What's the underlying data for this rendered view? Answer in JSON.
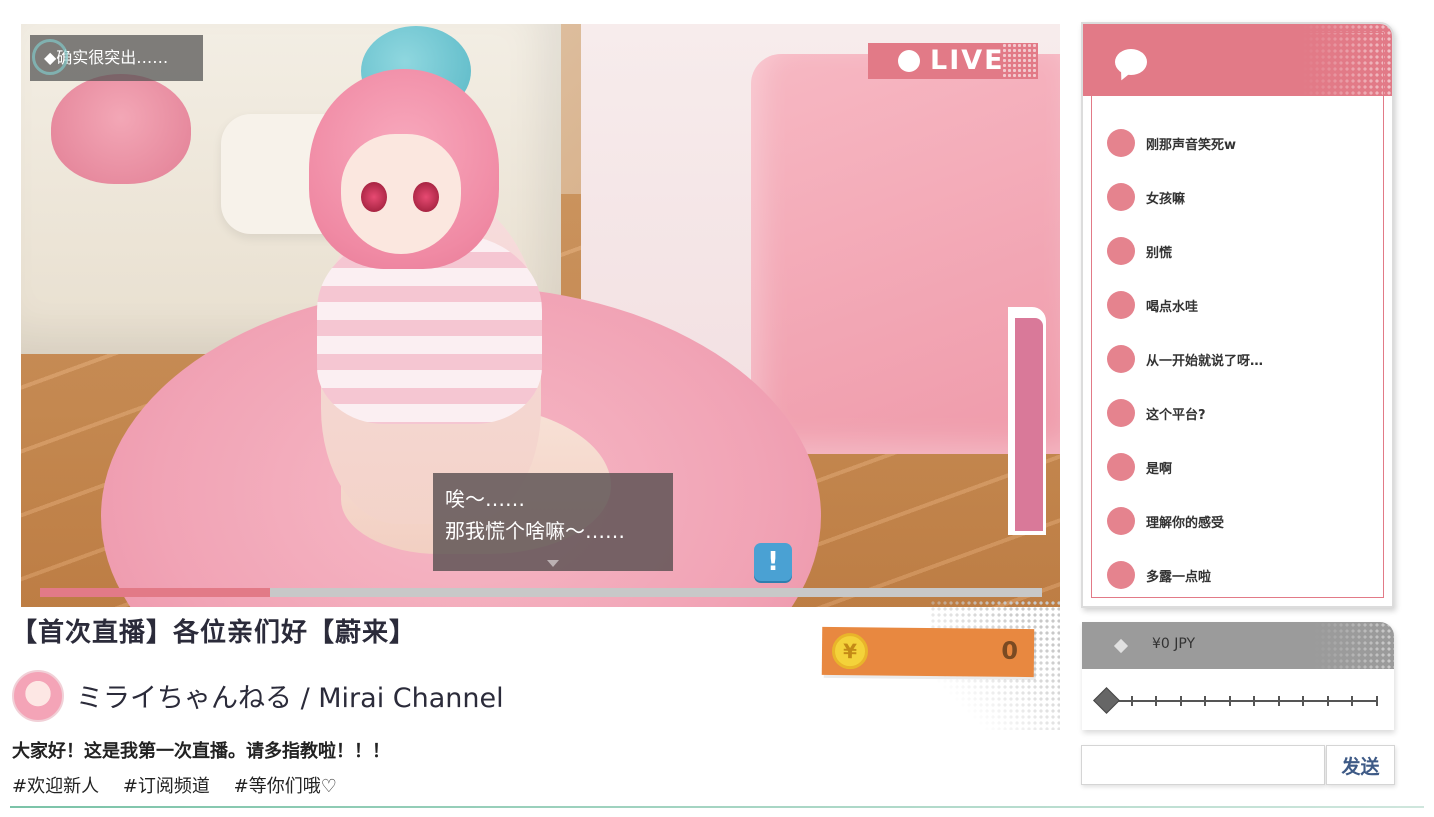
{
  "video": {
    "notice_text": "◆确实很突出……",
    "live_label": "LIVE",
    "dialog_line1": "唉～……",
    "dialog_line2": "那我慌个啥嘛～……",
    "alert_glyph": "!",
    "progress_fraction": 0.23,
    "meter_fraction": 1.0
  },
  "stream": {
    "title": "【首次直播】各位亲们好【蔚来】",
    "channel_name": "ミライちゃんねる / Mirai Channel",
    "description": "大家好！这是我第一次直播。请多指教啦！！！",
    "tags": [
      "#欢迎新人",
      "#订阅频道",
      "#等你们哦♡"
    ]
  },
  "coins": {
    "symbol": "¥",
    "value": "0"
  },
  "chat": {
    "icon": "speech-bubble-icon",
    "messages": [
      "刚那声音笑死w",
      "女孩嘛",
      "别慌",
      "喝点水哇",
      "从一开始就说了呀…",
      "这个平台?",
      "是啊",
      "理解你的感受",
      "多露一点啦"
    ]
  },
  "tip": {
    "amount": "¥0 JPY",
    "slider_value_fraction": 0
  },
  "send": {
    "input_value": "",
    "button_label": "发送"
  },
  "colors": {
    "accent_pink": "#e27a87",
    "coin_orange": "#e88840",
    "send_text": "#3e5a86"
  }
}
